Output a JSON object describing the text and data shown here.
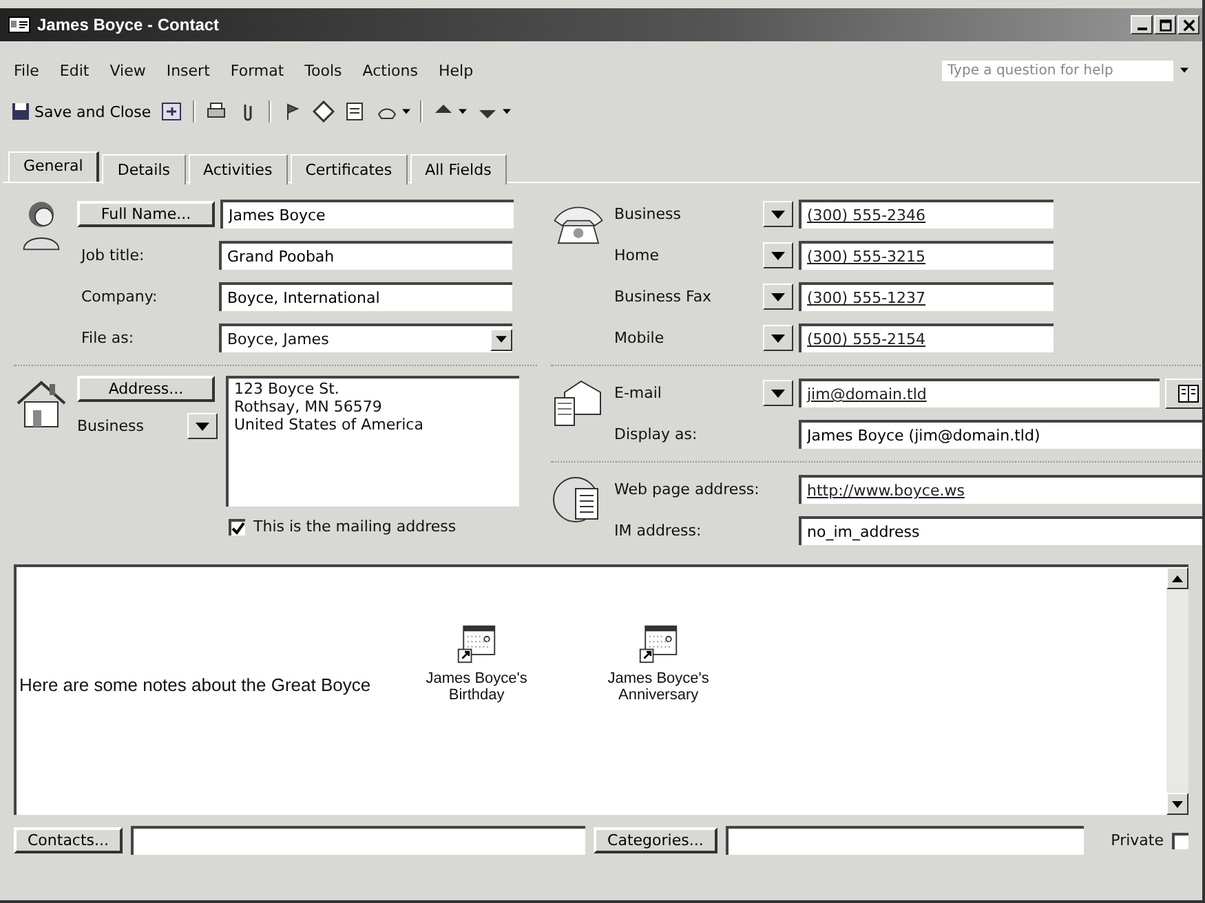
{
  "window": {
    "title": "James Boyce - Contact"
  },
  "menu": [
    "File",
    "Edit",
    "View",
    "Insert",
    "Format",
    "Tools",
    "Actions",
    "Help"
  ],
  "help_search": {
    "placeholder": "Type a question for help"
  },
  "toolbar": {
    "save_label": "Save and Close"
  },
  "tabs": [
    {
      "label": "General",
      "selected": true
    },
    {
      "label": "Details",
      "selected": false
    },
    {
      "label": "Activities",
      "selected": false
    },
    {
      "label": "Certificates",
      "selected": false
    },
    {
      "label": "All Fields",
      "selected": false
    }
  ],
  "name_section": {
    "full_name_button": "Full Name...",
    "full_name": "James Boyce",
    "job_title_label": "Job title:",
    "job_title": "Grand Poobah",
    "company_label": "Company:",
    "company": "Boyce, International",
    "file_as_label": "File as:",
    "file_as": "Boyce, James"
  },
  "address_section": {
    "address_button": "Address...",
    "address_type": "Business",
    "address_lines": [
      "123 Boyce St.",
      "Rothsay, MN  56579",
      "United States of America"
    ],
    "mailing_label": "This is the mailing address",
    "mailing_checked": true
  },
  "phones": [
    {
      "label": "Business",
      "value": "(300) 555-2346"
    },
    {
      "label": "Home",
      "value": "(300) 555-3215"
    },
    {
      "label": "Business Fax",
      "value": "(300) 555-1237"
    },
    {
      "label": "Mobile",
      "value": "(500) 555-2154"
    }
  ],
  "email_section": {
    "email_label": "E-mail",
    "email": "jim@domain.tld",
    "display_label": "Display as:",
    "display": "James Boyce (jim@domain.tld)"
  },
  "web_section": {
    "web_label": "Web page address:",
    "web": "http://www.boyce.ws",
    "im_label": "IM address:",
    "im": "no_im_address"
  },
  "notes": {
    "text": "Here are some notes about the Great Boyce",
    "attachments": [
      {
        "label": "James Boyce's Birthday"
      },
      {
        "label": "James Boyce's Anniversary"
      }
    ]
  },
  "footer": {
    "contacts_button": "Contacts...",
    "categories_button": "Categories...",
    "private_label": "Private",
    "private_checked": false
  }
}
